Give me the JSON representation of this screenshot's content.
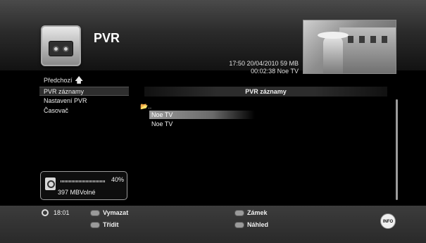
{
  "app": {
    "title": "PVR"
  },
  "header": {
    "info_line1": "17:50 20/04/2010 59 MB",
    "info_line2": "00:02:38 Noe TV"
  },
  "sidebar": {
    "back_label": "Předchozí",
    "items": [
      {
        "label": "PVR záznamy",
        "active": true
      },
      {
        "label": "Nastavení PVR",
        "active": false
      },
      {
        "label": "Časovač",
        "active": false
      }
    ]
  },
  "storage": {
    "percent": "40%",
    "free": "397 MBVolné",
    "used_fraction": 0.4
  },
  "list": {
    "title": "PVR záznamy",
    "parent": "..",
    "rows": [
      {
        "label": "Noe TV",
        "selected": true
      },
      {
        "label": "Noe TV",
        "selected": false
      }
    ]
  },
  "footer": {
    "time": "18:01",
    "keys": [
      {
        "label": "Vymazat"
      },
      {
        "label": "Třídit"
      },
      {
        "label": "Zámek"
      },
      {
        "label": "Náhled"
      }
    ],
    "info_button": "INFO"
  },
  "icons": {
    "pvr": "tape-recorder-icon",
    "back": "arrow-up-icon",
    "hdd": "hard-disk-icon",
    "folder": "folder-up-icon",
    "clock": "clock-icon"
  }
}
